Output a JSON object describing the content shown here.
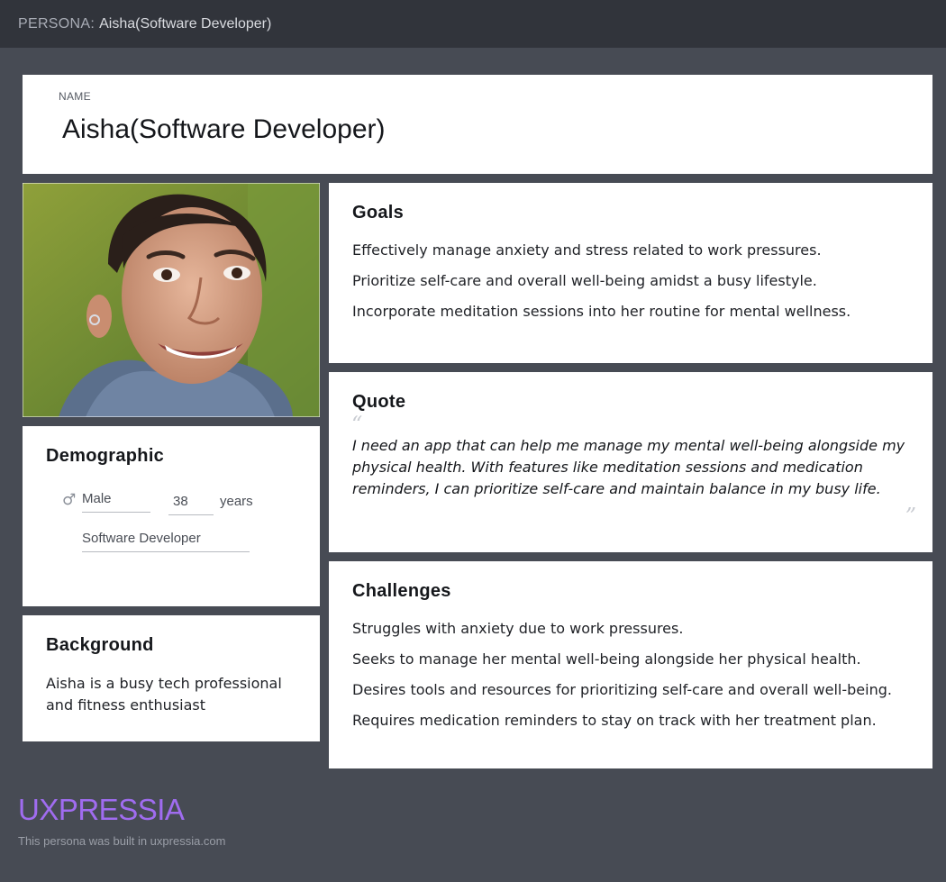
{
  "header": {
    "prefix": "PERSONA:",
    "title": "Aisha(Software Developer)"
  },
  "name_card": {
    "label": "NAME",
    "value": "Aisha(Software Developer)"
  },
  "goals": {
    "title": "Goals",
    "items": [
      "Effectively manage anxiety and stress related to work pressures.",
      "Prioritize self-care and overall well-being amidst a busy lifestyle.",
      "Incorporate meditation sessions into her routine for mental wellness."
    ]
  },
  "quote": {
    "title": "Quote",
    "text": "I need an app that can help me manage my mental well-being alongside my physical health. With features like meditation sessions and medication reminders, I can prioritize self-care and maintain balance in my busy life."
  },
  "challenges": {
    "title": "Challenges",
    "items": [
      "Struggles with anxiety due to work pressures.",
      "Seeks to manage her mental well-being alongside her physical health.",
      "Desires tools and resources for prioritizing self-care and overall well-being.",
      "Requires medication reminders to stay on track with her treatment plan."
    ]
  },
  "demographic": {
    "title": "Demographic",
    "gender": "Male",
    "gender_icon": "male-symbol-icon",
    "age": "38",
    "age_unit": "years",
    "occupation": "Software Developer"
  },
  "background": {
    "title": "Background",
    "text": "Aisha is a busy tech professional and fitness enthusiast"
  },
  "footer": {
    "logo": "UXPRESSIA",
    "note": "This persona was built in uxpressia.com"
  },
  "colors": {
    "page_bg": "#474b54",
    "topbar_bg": "#31343b",
    "card_bg": "#ffffff",
    "logo": "#a06cf0"
  }
}
